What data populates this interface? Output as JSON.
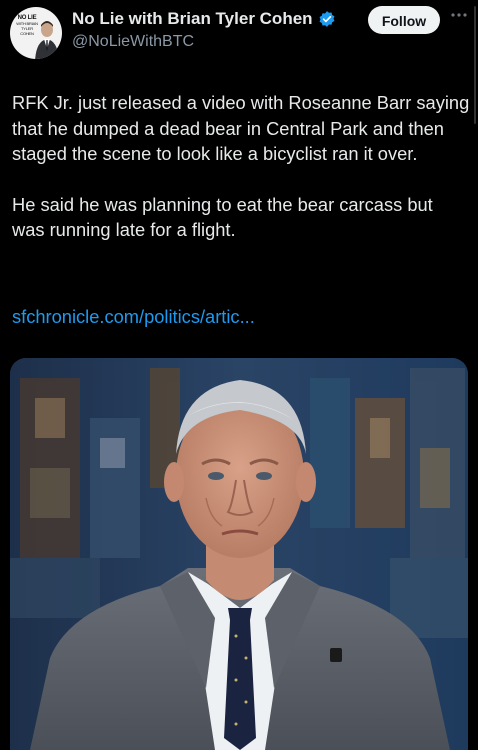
{
  "author": {
    "display_name": "No Lie with Brian Tyler Cohen",
    "handle": "@NoLieWithBTC",
    "avatar_logo_text": "NO LIE",
    "avatar_logo_subtext": "WITH BRIAN TYLER COHEN",
    "verified": true
  },
  "actions": {
    "follow_label": "Follow",
    "more_icon": "ellipsis-icon"
  },
  "tweet": {
    "paragraphs": [
      "RFK Jr. just released a video with Roseanne Barr saying that he dumped a dead bear in Central Park and then staged the scene to look like a bicyclist ran it over.",
      "He said he was planning to eat the bear carcass but was running late for a flight."
    ],
    "link_text": "sfchronicle.com/politics/artic..."
  },
  "colors": {
    "background": "#000000",
    "text": "#e7e9ea",
    "secondary_text": "#8b98a5",
    "link": "#1d9bf0",
    "verified_badge": "#1d9bf0",
    "follow_button_bg": "#eff3f4"
  }
}
